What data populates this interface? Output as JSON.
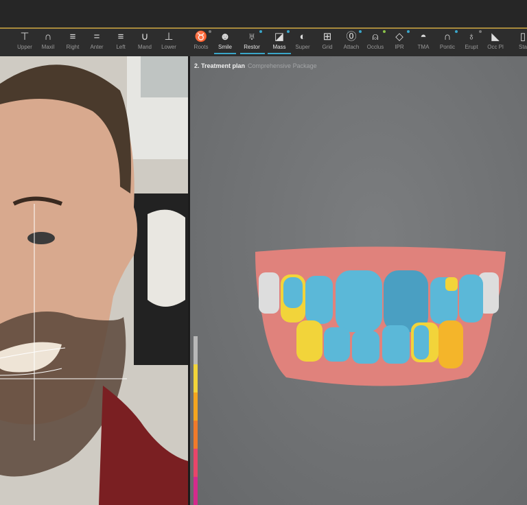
{
  "toolbar": {
    "items": [
      {
        "label": "Upper",
        "icon": "upper-arch-icon",
        "glyph": "⊤"
      },
      {
        "label": "Maxil",
        "icon": "maxillary-icon",
        "glyph": "∩"
      },
      {
        "label": "Right",
        "icon": "right-view-icon",
        "glyph": "≡"
      },
      {
        "label": "Anter",
        "icon": "anterior-view-icon",
        "glyph": "="
      },
      {
        "label": "Left",
        "icon": "left-view-icon",
        "glyph": "≡"
      },
      {
        "label": "Mand",
        "icon": "mandibular-icon",
        "glyph": "∪"
      },
      {
        "label": "Lower",
        "icon": "lower-arch-icon",
        "glyph": "⊥"
      },
      {
        "label": "Roots",
        "icon": "roots-icon",
        "glyph": "♉"
      },
      {
        "label": "Smile",
        "icon": "smile-icon",
        "glyph": "☻"
      },
      {
        "label": "Restor",
        "icon": "restoration-icon",
        "glyph": "♅"
      },
      {
        "label": "Mass",
        "icon": "mass-icon",
        "glyph": "◪"
      },
      {
        "label": "Super",
        "icon": "superimpose-icon",
        "glyph": "◐"
      },
      {
        "label": "Grid",
        "icon": "grid-icon",
        "glyph": "⊞"
      },
      {
        "label": "Attach",
        "icon": "attachment-icon",
        "glyph": "⓪"
      },
      {
        "label": "Occlus",
        "icon": "occlusion-icon",
        "glyph": "⍝"
      },
      {
        "label": "IPR",
        "icon": "ipr-icon",
        "glyph": "◇"
      },
      {
        "label": "TMA",
        "icon": "tma-gauge-icon",
        "glyph": "◓"
      },
      {
        "label": "Pontic",
        "icon": "pontic-icon",
        "glyph": "∩"
      },
      {
        "label": "Erupt",
        "icon": "eruption-icon",
        "glyph": "♁"
      },
      {
        "label": "Occ Pl",
        "icon": "occlusal-plane-icon",
        "glyph": "◣"
      },
      {
        "label": "Sta",
        "icon": "staging-icon",
        "glyph": "▯"
      }
    ],
    "active": [
      "Smile",
      "Restor",
      "Mass"
    ]
  },
  "view": {
    "title": "2. Treatment plan",
    "subtitle": "Comprehensive Package"
  },
  "colors": {
    "accent": "#3aa6c9",
    "gold": "#a88a3c",
    "tooth_blue": "#5bb8d8",
    "tooth_yellow": "#f2d43a",
    "gum": "#e0827c",
    "scale": [
      "#b8b8b8",
      "#f2d43a",
      "#f4a51f",
      "#f07a2a",
      "#e8456a",
      "#d42a8c"
    ]
  }
}
